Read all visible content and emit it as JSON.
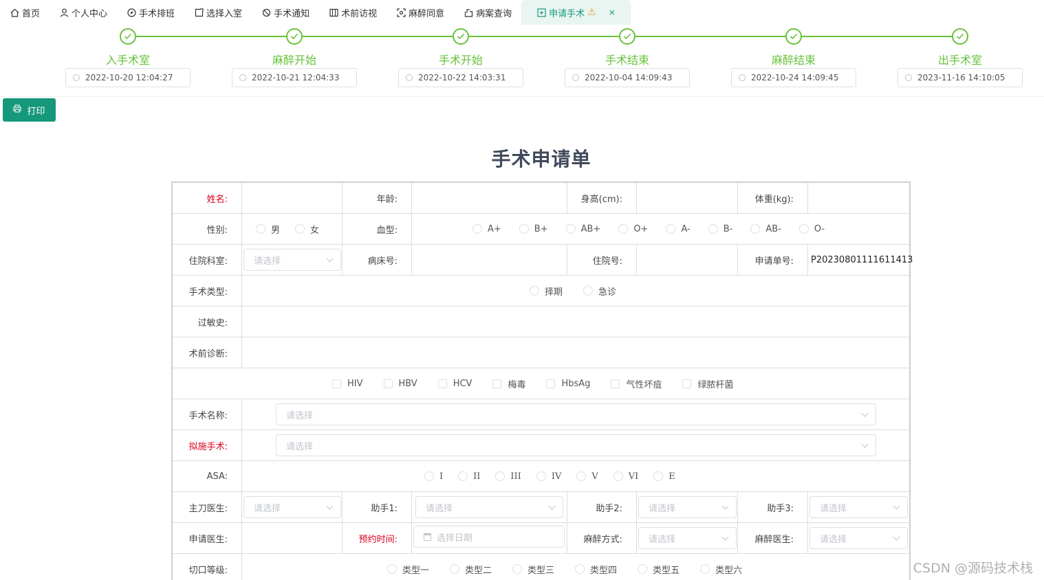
{
  "nav": {
    "tabs": [
      {
        "label": "首页",
        "icon": "home-icon"
      },
      {
        "label": "个人中心",
        "icon": "user-icon"
      },
      {
        "label": "手术排班",
        "icon": "compass-icon"
      },
      {
        "label": "选择入室",
        "icon": "enter-icon"
      },
      {
        "label": "手术通知",
        "icon": "bell-off-icon"
      },
      {
        "label": "术前访视",
        "icon": "visit-icon"
      },
      {
        "label": "麻醉同意",
        "icon": "scan-icon"
      },
      {
        "label": "病案查询",
        "icon": "share-icon"
      }
    ],
    "active_tab": {
      "label": "申请手术",
      "icon": "apply-icon",
      "warning": "⚠",
      "close": "×"
    }
  },
  "steps": [
    {
      "label": "入手术室",
      "time": "2022-10-20 12:04:27"
    },
    {
      "label": "麻醉开始",
      "time": "2022-10-21 12:04:33"
    },
    {
      "label": "手术开始",
      "time": "2022-10-22 14:03:31"
    },
    {
      "label": "手术结束",
      "time": "2022-10-04 14:09:43"
    },
    {
      "label": "麻醉结束",
      "time": "2022-10-24 14:09:45"
    },
    {
      "label": "出手术室",
      "time": "2023-11-16 14:10:05"
    }
  ],
  "colors": {
    "accent": "#16997a",
    "step": "#67c23a",
    "required": "#d9001b"
  },
  "print_label": "打印",
  "form": {
    "title": "手术申请单",
    "name_label": "姓名:",
    "age_label": "年龄:",
    "height_label": "身高(cm):",
    "weight_label": "体重(kg):",
    "gender_label": "性别:",
    "gender_options": [
      "男",
      "女"
    ],
    "blood_label": "血型:",
    "blood_options": [
      "A+",
      "B+",
      "AB+",
      "O+",
      "A-",
      "B-",
      "AB-",
      "O-"
    ],
    "dept_label": "住院科室:",
    "bed_label": "病床号:",
    "admission_label": "住院号:",
    "apply_no_label": "申请单号:",
    "apply_no_value": "P20230801111611413",
    "surgery_type_label": "手术类型:",
    "surgery_type_options": [
      "择期",
      "急诊"
    ],
    "allergy_label": "过敏史:",
    "diagnosis_label": "术前诊断:",
    "infection_options": [
      "HIV",
      "HBV",
      "HCV",
      "梅毒",
      "HbsAg",
      "气性坏疽",
      "绿脓杆菌"
    ],
    "surgery_name_label": "手术名称:",
    "planned_surgery_label": "拟施手术:",
    "asa_label": "ASA:",
    "asa_options": [
      "I",
      "II",
      "III",
      "IV",
      "V",
      "VI",
      "E"
    ],
    "surgeon_label": "主刀医生:",
    "assistant1_label": "助手1:",
    "assistant2_label": "助手2:",
    "assistant3_label": "助手3:",
    "applicant_label": "申请医生:",
    "appointment_label": "预约时间:",
    "anesthesia_method_label": "麻醉方式:",
    "anesthetist_label": "麻醉医生:",
    "incision_label": "切口等级:",
    "incision_options": [
      "类型一",
      "类型二",
      "类型三",
      "类型四",
      "类型五",
      "类型六"
    ],
    "select_placeholder": "请选择",
    "date_placeholder": "选择日期"
  },
  "watermark": "CSDN @源码技术栈"
}
